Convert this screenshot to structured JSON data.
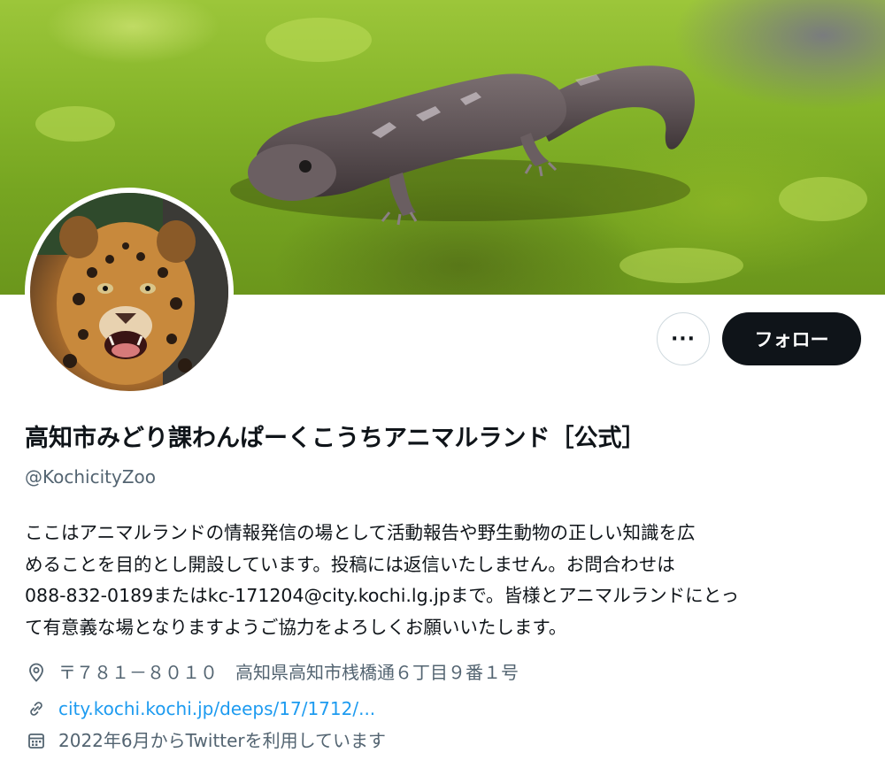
{
  "profile": {
    "display_name": "高知市みどり課わんぱーくこうちアニマルランド［公式］",
    "handle": "@KochicityZoo",
    "bio": "ここはアニマルランドの情報発信の場として活動報告や野生動物の正しい知識を広\nめることを目的とし開設しています。投稿には返信いたしません。お問合わせは\n088-832-0189またはkc-171204@city.kochi.lg.jpまで。皆様とアニマルランドにとっ\nて有意義な場となりますようご協力をよろしくお願いいたします。",
    "location": "〒７８１－８０１０　高知県高知市桟橋通６丁目９番１号",
    "website": "city.kochi.kochi.jp/deeps/17/1712/...",
    "joined": "2022年6月からTwitterを利用しています"
  },
  "actions": {
    "more_label": "···",
    "follow_label": "フォロー"
  },
  "icons": {
    "more": "more-icon",
    "location": "location-pin-icon",
    "website": "link-icon",
    "joined": "calendar-icon"
  },
  "colors": {
    "follow_bg": "#0f1419",
    "link": "#1d9bf0",
    "secondary_text": "#536471"
  }
}
